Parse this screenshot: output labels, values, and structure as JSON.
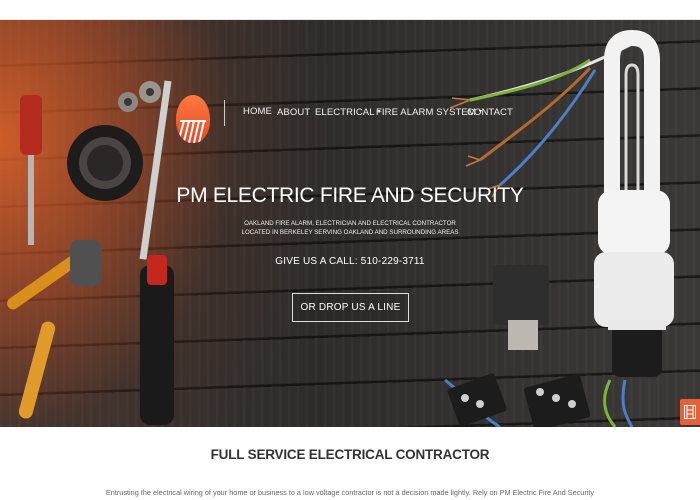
{
  "nav": {
    "items": [
      {
        "label": "HOME",
        "has_dropdown": false
      },
      {
        "label": "ABOUT",
        "has_dropdown": false
      },
      {
        "label": "ELECTRICAL",
        "has_dropdown": true
      },
      {
        "label": "FIRE ALARM SYSTEM",
        "has_dropdown": true
      },
      {
        "label": "CONTACT",
        "has_dropdown": false
      }
    ],
    "caret_glyph": "▾"
  },
  "hero": {
    "title": "PM ELECTRIC FIRE AND SECURITY",
    "subtitle_line1": "OAKLAND FIRE ALARM, ELECTRICIAN AND ELECTRICAL CONTRACTOR",
    "subtitle_line2": "LOCATED IN BERKELEY SERVING OAKLAND AND SURROUNDING AREAS",
    "call_text": "GIVE US A CALL: 510-229-3711",
    "cta_label": "OR DROP US A LINE"
  },
  "section": {
    "title": "FULL SERVICE ELECTRICAL CONTRACTOR",
    "text": "Entrusting the electrical wiring of your home or business to a low voltage contractor is not a decision made lightly. Rely on PM Electric Fire And Security"
  },
  "icons": {
    "logo": "pm-electric-logo-icon",
    "side_badge": "film-strip-icon"
  },
  "colors": {
    "accent_orange": "#e8603a",
    "logo_orange": "#ff7a3d",
    "hero_dark": "#2f2d2c",
    "text_white": "#ffffff",
    "section_title": "#333333",
    "section_text": "#666666"
  }
}
